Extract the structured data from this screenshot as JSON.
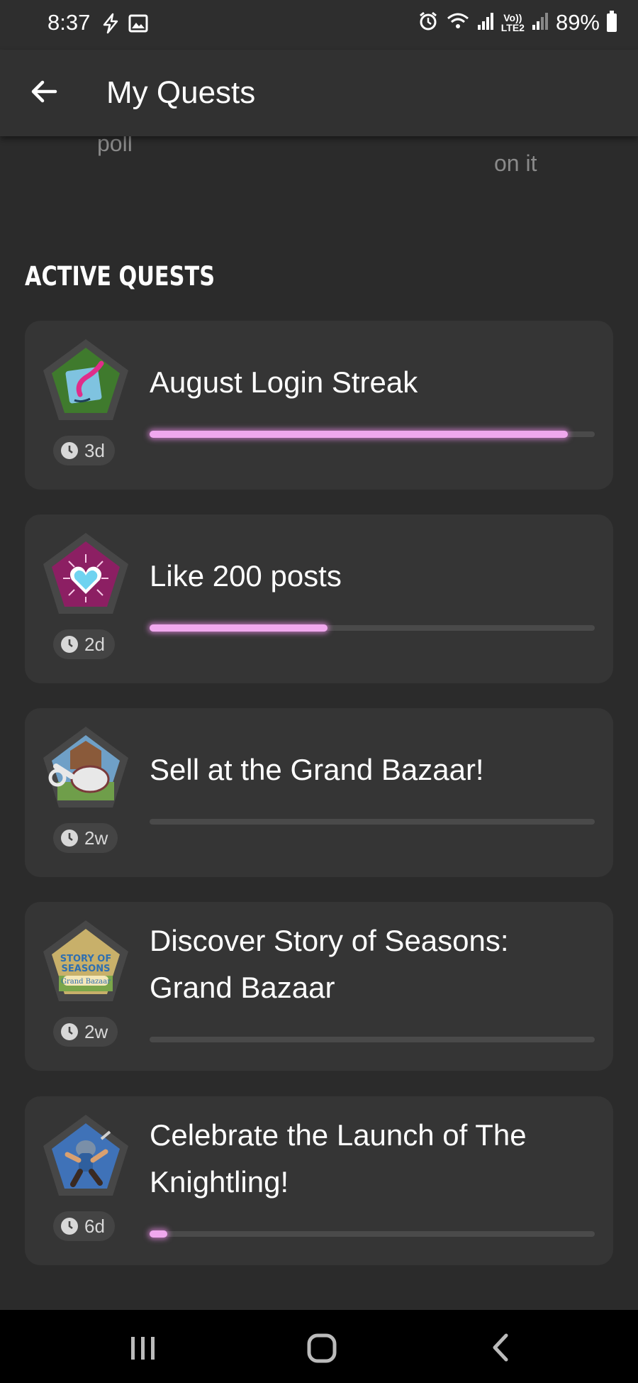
{
  "status_bar": {
    "time": "8:37",
    "battery": "89%",
    "lte_top": "Vo))",
    "lte_bottom": "LTE2",
    "left_icons": [
      "flash-icon",
      "image-icon"
    ],
    "right_icons": [
      "alarm-icon",
      "wifi-icon",
      "signal-icon",
      "signal-icon",
      "battery-icon"
    ]
  },
  "app_bar": {
    "title": "My Quests",
    "back_icon": "back-arrow-icon"
  },
  "peek": {
    "left_text": "poll",
    "right_text": "on it"
  },
  "section": {
    "heading": "ACTIVE QUESTS"
  },
  "quests": [
    {
      "title": "August Login Streak",
      "time_left": "3d",
      "progress": 0.94,
      "badge": "feather-quill-badge-icon",
      "badge_color": "#3f7a2d"
    },
    {
      "title": "Like 200 posts",
      "time_left": "2d",
      "progress": 0.4,
      "badge": "heart-badge-icon",
      "badge_color": "#8c1f63"
    },
    {
      "title": "Sell at the Grand Bazaar!",
      "time_left": "2w",
      "progress": 0.0,
      "badge": "watering-can-badge-icon",
      "badge_color": "#6fa0c7"
    },
    {
      "title": "Discover Story of Seasons: Grand Bazaar",
      "time_left": "2w",
      "progress": 0.0,
      "badge": "story-of-seasons-badge-icon",
      "badge_color": "#c8b06a",
      "badge_text_1": "STORY OF",
      "badge_text_2": "SEASONS",
      "badge_text_3": "Grand Bazaar"
    },
    {
      "title": "Celebrate the Launch of The Knightling!",
      "time_left": "6d",
      "progress": 0.04,
      "badge": "knight-badge-icon",
      "badge_color": "#3f72b8"
    }
  ],
  "colors": {
    "background": "#2b2b2b",
    "card": "#353535",
    "progress_fill": "#f0a8ee",
    "progress_track": "#4a4a4a"
  },
  "nav_bar": {
    "buttons": [
      "recent-apps-icon",
      "home-icon",
      "back-icon"
    ]
  }
}
